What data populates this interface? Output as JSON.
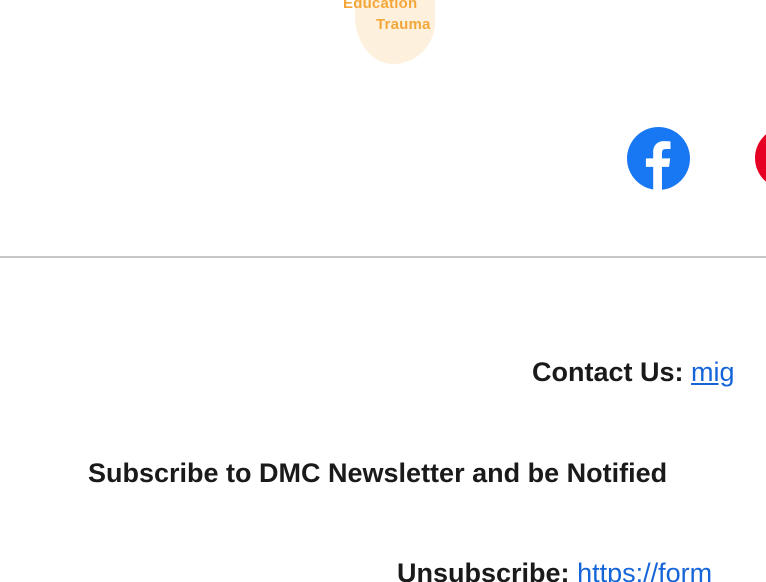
{
  "logo": {
    "word1": "Education",
    "word2": "Trauma",
    "color": "#f3a73a"
  },
  "social": {
    "facebook_icon": "facebook-icon",
    "second_icon": "pinterest-icon",
    "facebook_color": "#1877f2",
    "second_color": "#e60023"
  },
  "footer": {
    "contact_label": "Contact Us:",
    "contact_link": "mig",
    "subscribe_text": "Subscribe to DMC Newsletter and be Notified",
    "unsubscribe_label": "Unsubscribe:",
    "unsubscribe_link": "https://form"
  }
}
